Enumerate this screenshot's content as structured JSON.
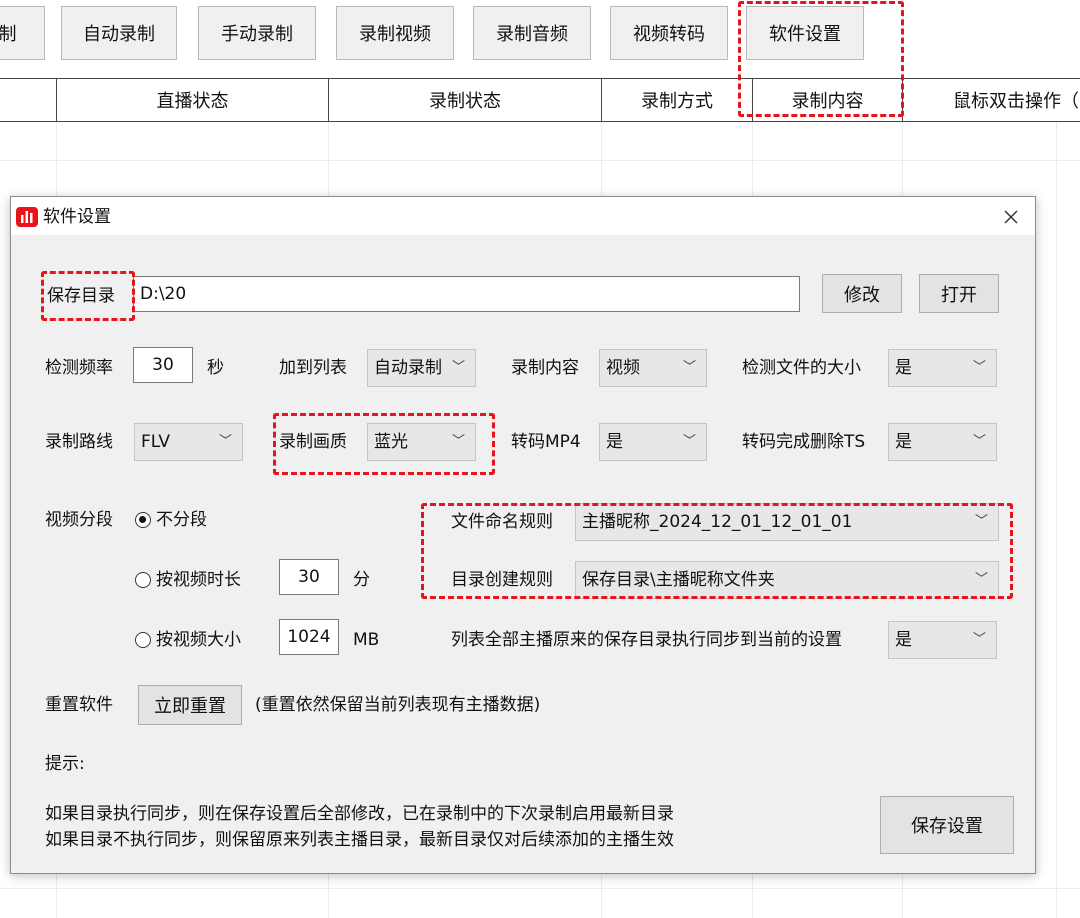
{
  "toolbar": {
    "buttons": [
      "制",
      "自动录制",
      "手动录制",
      "录制视频",
      "录制音频",
      "视频转码",
      "软件设置"
    ]
  },
  "table": {
    "columns": [
      "直播状态",
      "录制状态",
      "录制方式",
      "录制内容",
      "鼠标双击操作（"
    ]
  },
  "dialog": {
    "title": "软件设置",
    "close_icon": "close-icon",
    "app_icon": "app-logo-icon",
    "accent_color": "#e8141b",
    "save_dir": {
      "label": "保存目录",
      "value": "D:\\20",
      "modify": "修改",
      "open": "打开"
    },
    "check_freq": {
      "label": "检测频率",
      "value": "30",
      "unit": "秒"
    },
    "add_to_list": {
      "label": "加到列表",
      "value": "自动录制"
    },
    "record_content": {
      "label": "录制内容",
      "value": "视频"
    },
    "check_size": {
      "label": "检测文件的大小",
      "value": "是"
    },
    "record_route": {
      "label": "录制路线",
      "value": "FLV"
    },
    "record_quality": {
      "label": "录制画质",
      "value": "蓝光"
    },
    "transcode_mp4": {
      "label": "转码MP4",
      "value": "是"
    },
    "delete_ts": {
      "label": "转码完成删除TS",
      "value": "是"
    },
    "segment": {
      "label": "视频分段",
      "options": [
        "不分段",
        "按视频时长",
        "按视频大小"
      ],
      "selected": "不分段",
      "duration": {
        "value": "30",
        "unit": "分"
      },
      "size": {
        "value": "1024",
        "unit": "MB"
      }
    },
    "file_naming": {
      "label": "文件命名规则",
      "value": "主播昵称_2024_12_01_12_01_01"
    },
    "dir_rule": {
      "label": "目录创建规则",
      "value": "保存目录\\主播昵称文件夹"
    },
    "sync": {
      "label": "列表全部主播原来的保存目录执行同步到当前的设置",
      "value": "是"
    },
    "reset": {
      "label": "重置软件",
      "button": "立即重置",
      "note": "(重置依然保留当前列表现有主播数据)"
    },
    "tip": {
      "title": "提示:",
      "line1": "如果目录执行同步，则在保存设置后全部修改，已在录制中的下次录制启用最新目录",
      "line2": "如果目录不执行同步，则保留原来列表主播目录，最新目录仅对后续添加的主播生效"
    },
    "save_button": "保存设置"
  }
}
